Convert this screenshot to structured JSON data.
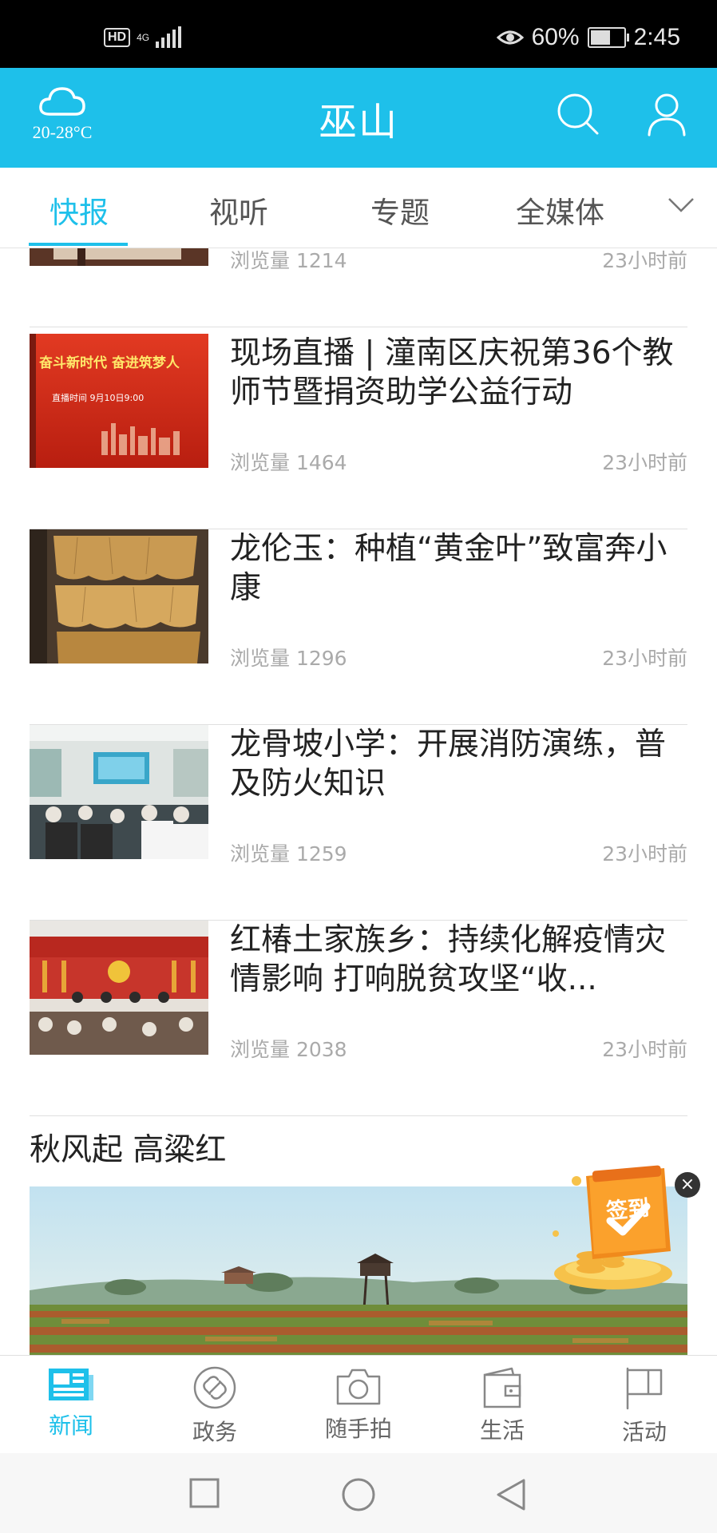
{
  "status_bar": {
    "hd": "HD",
    "network": "4G",
    "battery_percent": "60%",
    "time": "2:45"
  },
  "app_bar": {
    "weather_icon": "cloud-icon",
    "temperature": "20-28°C",
    "title": "巫山",
    "search_icon": "search-icon",
    "profile_icon": "user-icon"
  },
  "tabs": [
    {
      "label": "快报",
      "active": true
    },
    {
      "label": "视听",
      "active": false
    },
    {
      "label": "专题",
      "active": false
    },
    {
      "label": "全媒体",
      "active": false
    }
  ],
  "feed": {
    "partial_item": {
      "views": "浏览量 1214",
      "time": "23小时前"
    },
    "items": [
      {
        "title": "现场直播 | 潼南区庆祝第36个教师节暨捐资助学公益行动",
        "views": "浏览量 1464",
        "time": "23小时前",
        "thumb_text_1": "奋斗新时代 奋进筑梦人",
        "thumb_text_2": "直播时间 9月10日9:00"
      },
      {
        "title": "龙伦玉：种植“黄金叶”致富奔小康",
        "views": "浏览量 1296",
        "time": "23小时前"
      },
      {
        "title": "龙骨坡小学：开展消防演练，普及防火知识",
        "views": "浏览量 1259",
        "time": "23小时前"
      },
      {
        "title": "红椿土家族乡：持续化解疫情灾情影响 打响脱贫攻坚“收...",
        "views": "浏览量 2038",
        "time": "23小时前"
      }
    ],
    "section_title": "秋风起 高粱红"
  },
  "signin_float": {
    "label": "签到",
    "close": "×"
  },
  "bottom_nav": [
    {
      "label": "新闻",
      "icon": "news-icon",
      "active": true
    },
    {
      "label": "政务",
      "icon": "link-icon",
      "active": false
    },
    {
      "label": "随手拍",
      "icon": "camera-icon",
      "active": false
    },
    {
      "label": "生活",
      "icon": "wallet-icon",
      "active": false
    },
    {
      "label": "活动",
      "icon": "flag-icon",
      "active": false
    }
  ],
  "colors": {
    "accent": "#1ec0ea",
    "text": "#222222",
    "muted": "#aaaaaa"
  }
}
